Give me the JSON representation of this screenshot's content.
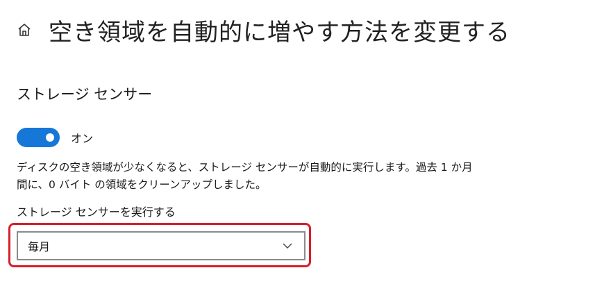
{
  "header": {
    "title": "空き領域を自動的に増やす方法を変更する",
    "home_icon": "home-icon"
  },
  "storage_sense": {
    "section_title": "ストレージ センサー",
    "toggle_state_label": "オン",
    "toggle_on": true,
    "accent_color": "#1677d8",
    "description": "ディスクの空き領域が少なくなると、ストレージ センサーが自動的に実行します。過去 1 か月間に、0 バイト の領域をクリーンアップしました。",
    "run_label": "ストレージ センサーを実行する",
    "run_frequency_selected": "毎月",
    "highlight_color": "#d81e2a"
  }
}
